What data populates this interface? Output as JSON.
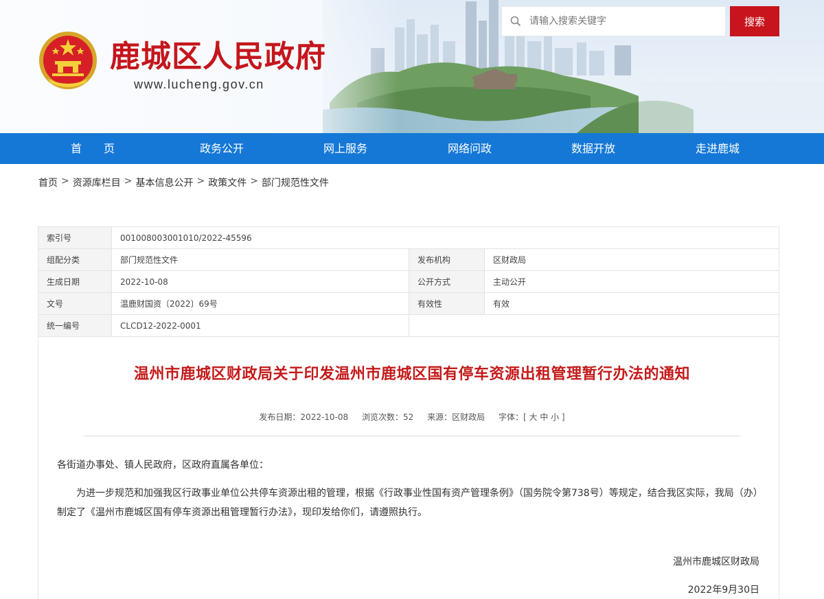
{
  "header": {
    "site_title": "鹿城区人民政府",
    "site_url": "www.lucheng.gov.cn",
    "search_placeholder": "请输入搜索关键字",
    "search_button": "搜索",
    "brand_color": "#c4161c"
  },
  "nav": {
    "color": "#1578d6",
    "items": [
      {
        "label": "首　　页"
      },
      {
        "label": "政务公开"
      },
      {
        "label": "网上服务"
      },
      {
        "label": "网络问政"
      },
      {
        "label": "数据开放"
      },
      {
        "label": "走进鹿城"
      }
    ]
  },
  "breadcrumb": {
    "items": [
      "首页",
      "资源库栏目",
      "基本信息公开",
      "政策文件",
      "部门规范性文件"
    ],
    "separator": ">"
  },
  "meta": {
    "index_label": "索引号",
    "index_value": "001008003001010/2022-45596",
    "category_label": "组配分类",
    "category_value": "部门规范性文件",
    "publisher_label": "发布机构",
    "publisher_value": "区财政局",
    "date_label": "生成日期",
    "date_value": "2022-10-08",
    "open_label": "公开方式",
    "open_value": "主动公开",
    "doc_no_label": "文号",
    "doc_no_value": "温鹿财国资〔2022〕69号",
    "validity_label": "有效性",
    "validity_value": "有效",
    "unified_label": "统一编号",
    "unified_value": "CLCD12-2022-0001"
  },
  "document": {
    "title": "温州市鹿城区财政局关于印发温州市鹿城区国有停车资源出租管理暂行办法的通知",
    "publish_date": "发布日期：2022-10-08",
    "views": "浏览次数：52",
    "source": "来源：区财政局",
    "font_size": "字体：[ 大 中 小 ]",
    "salutation": "各街道办事处、镇人民政府，区政府直属各单位：",
    "body": "为进一步规范和加强我区行政事业单位公共停车资源出租的管理，根据《行政事业性国有资产管理条例》（国务院令第738号）等规定，结合我区实际，我局（办）制定了《温州市鹿城区国有停车资源出租管理暂行办法》，现印发给你们，请遵照执行。",
    "sign_org": "温州市鹿城区财政局",
    "sign_date": "2022年9月30日"
  }
}
